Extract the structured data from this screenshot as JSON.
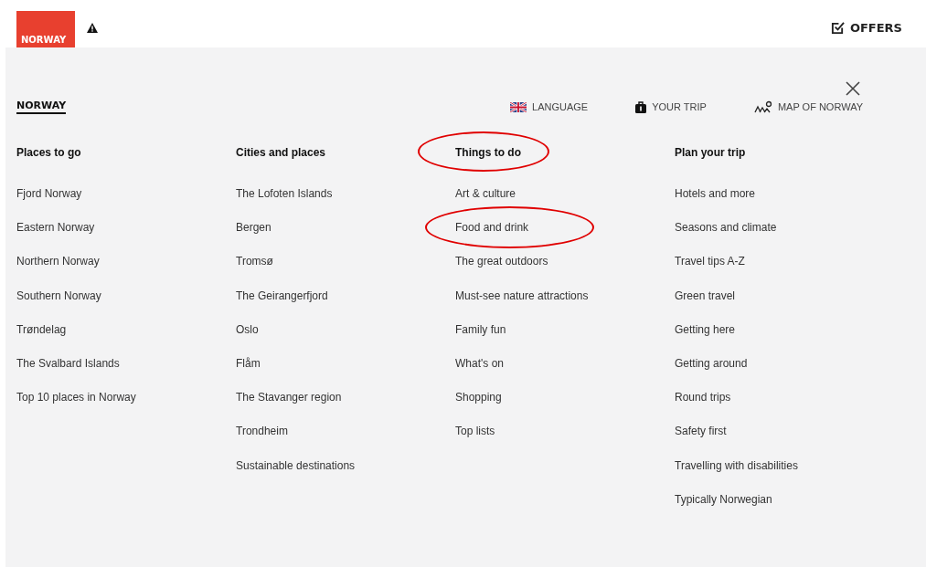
{
  "header": {
    "logo": "NORWAY",
    "offers": "OFFERS"
  },
  "menu": {
    "home_link": "NORWAY",
    "utilities": [
      {
        "kind": "flag",
        "label": "LANGUAGE"
      },
      {
        "kind": "bag",
        "label": "YOUR TRIP"
      },
      {
        "kind": "map",
        "label": "MAP OF NORWAY"
      }
    ],
    "columns": [
      {
        "heading": "Places to go",
        "circled": false,
        "items": [
          {
            "label": "Fjord Norway",
            "circled": false
          },
          {
            "label": "Eastern Norway",
            "circled": false
          },
          {
            "label": "Northern Norway",
            "circled": false
          },
          {
            "label": "Southern Norway",
            "circled": false
          },
          {
            "label": "Trøndelag",
            "circled": false
          },
          {
            "label": "The Svalbard Islands",
            "circled": false
          },
          {
            "label": "Top 10 places in Norway",
            "circled": false
          }
        ]
      },
      {
        "heading": "Cities and places",
        "circled": false,
        "items": [
          {
            "label": "The Lofoten Islands",
            "circled": false
          },
          {
            "label": "Bergen",
            "circled": false
          },
          {
            "label": "Tromsø",
            "circled": false
          },
          {
            "label": "The Geirangerfjord",
            "circled": false
          },
          {
            "label": "Oslo",
            "circled": false
          },
          {
            "label": "Flåm",
            "circled": false
          },
          {
            "label": "The Stavanger region",
            "circled": false
          },
          {
            "label": "Trondheim",
            "circled": false
          },
          {
            "label": "Sustainable destinations",
            "circled": false
          }
        ]
      },
      {
        "heading": "Things to do",
        "circled": true,
        "items": [
          {
            "label": "Art & culture",
            "circled": false
          },
          {
            "label": "Food and drink",
            "circled": true
          },
          {
            "label": "The great outdoors",
            "circled": false
          },
          {
            "label": "Must-see nature attractions",
            "circled": false
          },
          {
            "label": "Family fun",
            "circled": false
          },
          {
            "label": "What's on",
            "circled": false
          },
          {
            "label": "Shopping",
            "circled": false
          },
          {
            "label": "Top lists",
            "circled": false
          }
        ]
      },
      {
        "heading": "Plan your trip",
        "circled": false,
        "items": [
          {
            "label": "Hotels and more",
            "circled": false
          },
          {
            "label": "Seasons and climate",
            "circled": false
          },
          {
            "label": "Travel tips A-Z",
            "circled": false
          },
          {
            "label": "Green travel",
            "circled": false
          },
          {
            "label": "Getting here",
            "circled": false
          },
          {
            "label": "Getting around",
            "circled": false
          },
          {
            "label": "Round trips",
            "circled": false
          },
          {
            "label": "Safety first",
            "circled": false
          },
          {
            "label": "Travelling with disabilities",
            "circled": false
          },
          {
            "label": "Typically Norwegian",
            "circled": false
          }
        ]
      }
    ]
  }
}
